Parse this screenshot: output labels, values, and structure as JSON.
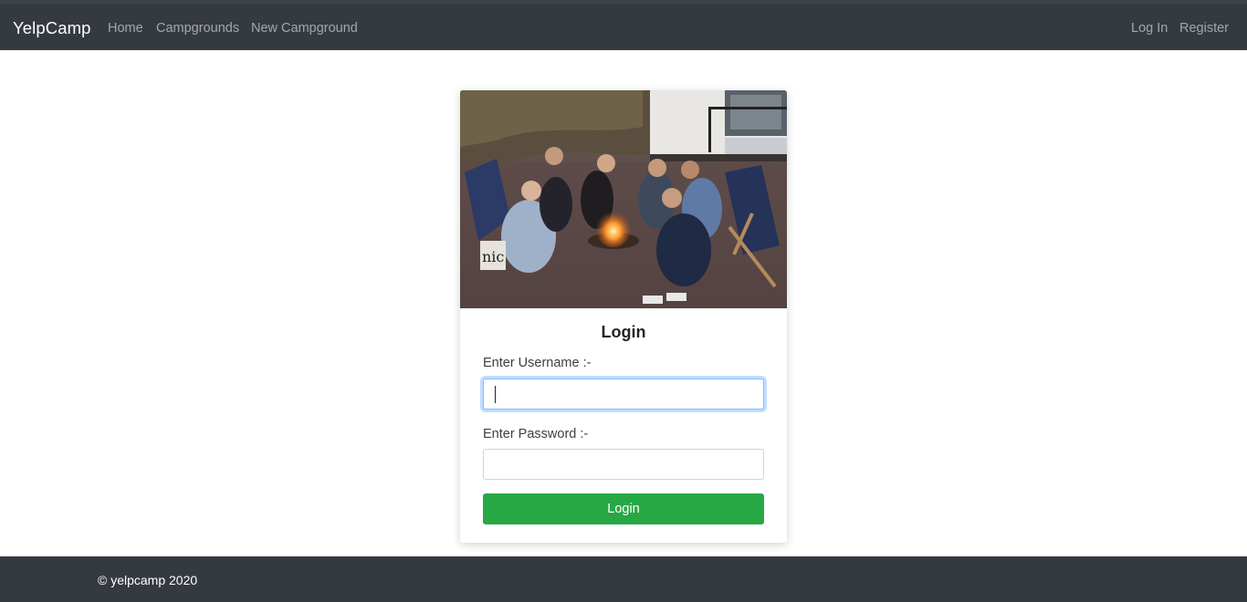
{
  "navbar": {
    "brand": "YelpCamp",
    "links": [
      "Home",
      "Campgrounds",
      "New Campground"
    ],
    "right_links": [
      "Log In",
      "Register"
    ]
  },
  "login_card": {
    "title": "Login",
    "username_label": "Enter Username :-",
    "username_value": "",
    "password_label": "Enter Password :-",
    "password_value": "",
    "submit_label": "Login",
    "image_subject": "group of friends around a campfire on a beach"
  },
  "footer": {
    "text": "© yelpcamp 2020"
  },
  "colors": {
    "navbar_bg": "#343a40",
    "button_green": "#28a745",
    "focus_blue": "#80bdff"
  }
}
